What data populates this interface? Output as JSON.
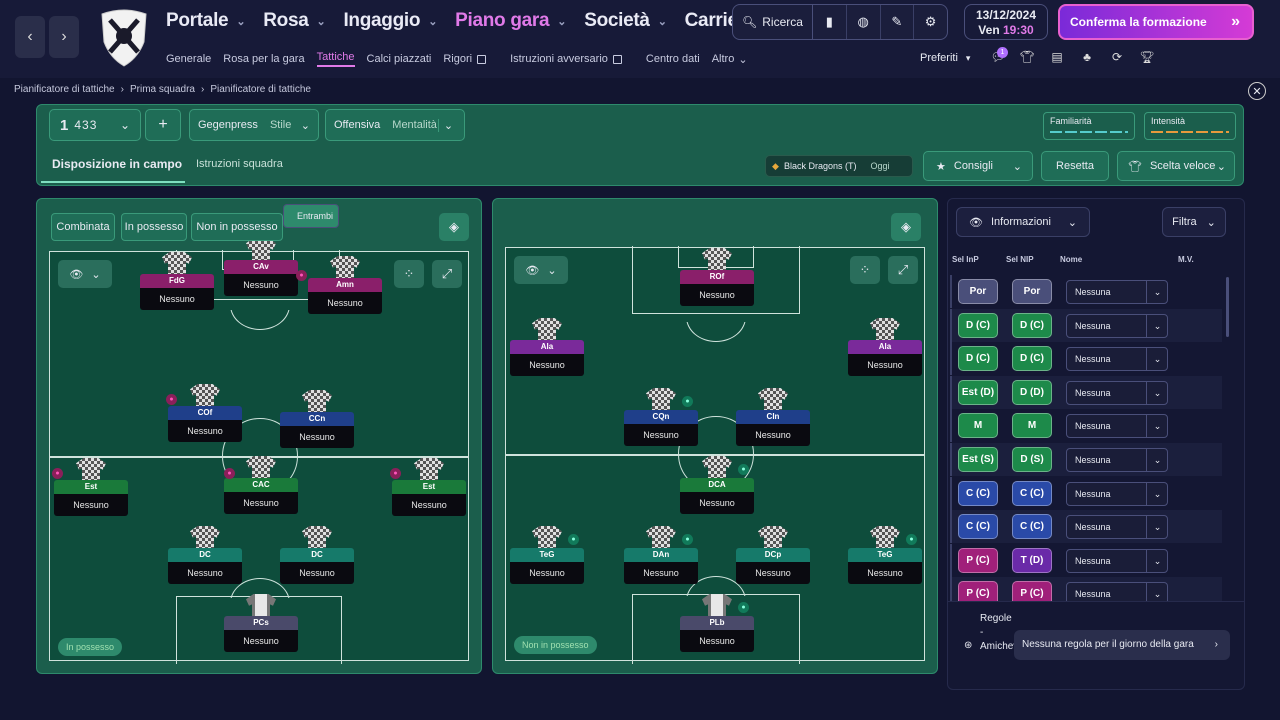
{
  "nav": {
    "main": [
      "Portale",
      "Rosa",
      "Ingaggio",
      "Piano gara",
      "Società",
      "Carriera"
    ],
    "active_main": "Piano gara",
    "sub": [
      "Generale",
      "Rosa per la gara",
      "Tattiche",
      "Calci piazzati",
      "Rigori",
      "Istruzioni avversario",
      "Centro dati",
      "Altro"
    ],
    "active_sub": "Tattiche",
    "search": "Ricerca",
    "date": "13/12/2024",
    "day": "Ven",
    "time": "19:30",
    "confirm": "Conferma la formazione",
    "preferiti": "Preferiti",
    "notif_count": "1"
  },
  "breadcrumb": [
    "Pianificatore di tattiche",
    "Prima squadra",
    "Pianificatore di tattiche"
  ],
  "tactic": {
    "formation_num": "1",
    "formation": "433",
    "gegen_label": "Gegenpress",
    "gegen_val": "Stile",
    "off_label": "Offensiva",
    "off_val": "Mentalità",
    "familiarity": "Familiarità",
    "intensity": "Intensità",
    "tab_active": "Disposizione in campo",
    "tab_other": "Istruzioni squadra",
    "opponent": "Black Dragons (T)",
    "opponent_when": "Oggi",
    "advice": "Consigli",
    "reset": "Resetta",
    "quick": "Scelta veloce"
  },
  "modes": [
    "Combinata",
    "In possesso",
    "Non in possesso",
    "Entrambi"
  ],
  "left_tag": "In possesso",
  "right_tag": "Non in possesso",
  "left_players": [
    {
      "role": "FdG",
      "name": "Nessuno",
      "c": "r-mag"
    },
    {
      "role": "CAv",
      "name": "Nessuno",
      "c": "r-mag"
    },
    {
      "role": "Amn",
      "name": "Nessuno",
      "c": "r-mag"
    },
    {
      "role": "COf",
      "name": "Nessuno",
      "c": "r-blu"
    },
    {
      "role": "CCn",
      "name": "Nessuno",
      "c": "r-blu"
    },
    {
      "role": "Est",
      "name": "Nessuno",
      "c": "r-grn"
    },
    {
      "role": "CAC",
      "name": "Nessuno",
      "c": "r-grn"
    },
    {
      "role": "Est",
      "name": "Nessuno",
      "c": "r-grn"
    },
    {
      "role": "DC",
      "name": "Nessuno",
      "c": "r-tea"
    },
    {
      "role": "DC",
      "name": "Nessuno",
      "c": "r-tea"
    },
    {
      "role": "PCs",
      "name": "Nessuno",
      "c": "r-gry"
    }
  ],
  "right_players": [
    {
      "role": "ROf",
      "name": "Nessuno",
      "c": "r-mag"
    },
    {
      "role": "Ala",
      "name": "Nessuno",
      "c": "r-pur"
    },
    {
      "role": "Ala",
      "name": "Nessuno",
      "c": "r-pur"
    },
    {
      "role": "CQn",
      "name": "Nessuno",
      "c": "r-blu"
    },
    {
      "role": "CIn",
      "name": "Nessuno",
      "c": "r-blu"
    },
    {
      "role": "DCA",
      "name": "Nessuno",
      "c": "r-grn"
    },
    {
      "role": "TeG",
      "name": "Nessuno",
      "c": "r-tea"
    },
    {
      "role": "DAn",
      "name": "Nessuno",
      "c": "r-tea"
    },
    {
      "role": "DCp",
      "name": "Nessuno",
      "c": "r-tea"
    },
    {
      "role": "TeG",
      "name": "Nessuno",
      "c": "r-tea"
    },
    {
      "role": "PLb",
      "name": "Nessuno",
      "c": "r-gry"
    }
  ],
  "panel": {
    "info": "Informazioni",
    "filter": "Filtra",
    "col_inp": "Sel InP",
    "col_nip": "Sel NIP",
    "col_name": "Nome",
    "col_mv": "M.V.",
    "rows": [
      {
        "a": "Por",
        "ac": "p-gry",
        "b": "Por",
        "bc": "p-gry",
        "n": "Nessuna"
      },
      {
        "a": "D (C)",
        "ac": "p-grn",
        "b": "D (C)",
        "bc": "p-grn",
        "n": "Nessuna"
      },
      {
        "a": "D (C)",
        "ac": "p-grn",
        "b": "D (C)",
        "bc": "p-grn",
        "n": "Nessuna"
      },
      {
        "a": "Est (D)",
        "ac": "p-grn",
        "b": "D (D)",
        "bc": "p-grn",
        "n": "Nessuna"
      },
      {
        "a": "M",
        "ac": "p-grn",
        "b": "M",
        "bc": "p-grn",
        "n": "Nessuna"
      },
      {
        "a": "Est (S)",
        "ac": "p-grn",
        "b": "D (S)",
        "bc": "p-grn",
        "n": "Nessuna"
      },
      {
        "a": "C (C)",
        "ac": "p-blu",
        "b": "C (C)",
        "bc": "p-blu",
        "n": "Nessuna"
      },
      {
        "a": "C (C)",
        "ac": "p-blu",
        "b": "C (C)",
        "bc": "p-blu",
        "n": "Nessuna"
      },
      {
        "a": "P (C)",
        "ac": "p-mag",
        "b": "T (D)",
        "bc": "p-pur",
        "n": "Nessuna"
      },
      {
        "a": "P (C)",
        "ac": "p-mag",
        "b": "P (C)",
        "bc": "p-mag",
        "n": "Nessuna"
      }
    ],
    "rules_label": "Regole - Amichevole",
    "rules_value": "Nessuna regola per il giorno della gara"
  }
}
